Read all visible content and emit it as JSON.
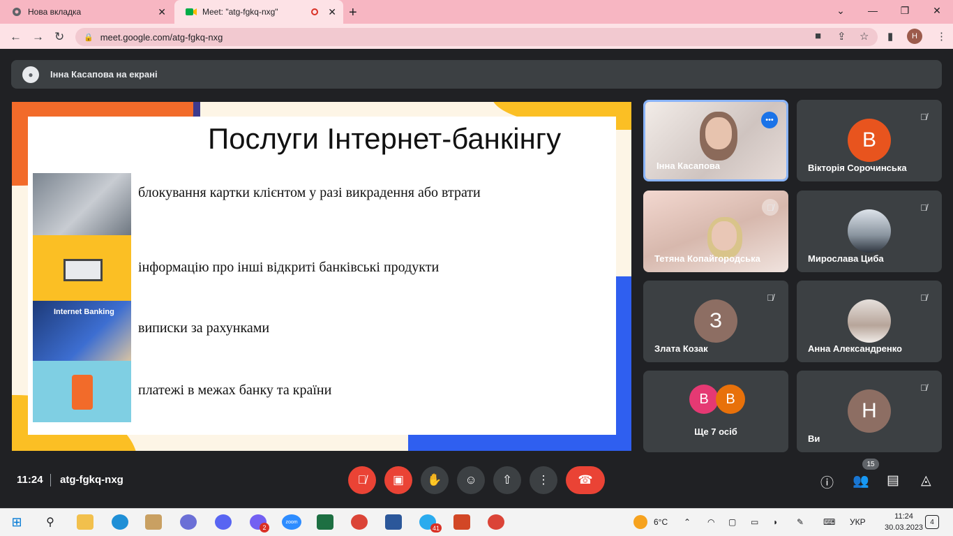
{
  "browser": {
    "tabs": [
      {
        "title": "Нова вкладка"
      },
      {
        "title": "Meet: \"atg-fgkq-nxg\""
      }
    ],
    "url": "meet.google.com/atg-fgkq-nxg",
    "profile_initial": "Н"
  },
  "meet": {
    "presenter_banner": "Інна Касапова на екрані",
    "slide": {
      "title": "Послуги Інтернет-банкінгу",
      "items": [
        "блокування картки клієнтом у разі викрадення або втрати",
        "інформацію про інші відкриті банківські продукти",
        "виписки за рахунками",
        "платежі в межах банку та країни"
      ],
      "image3_caption": "Internet Banking"
    },
    "participants": [
      {
        "name": "Інна Касапова",
        "type": "video"
      },
      {
        "name": "Вікторія Сорочинська",
        "initial": "В",
        "color": "#e8541e"
      },
      {
        "name": "Тетяна Копайгородська",
        "type": "video"
      },
      {
        "name": "Мирослава Циба",
        "type": "photo"
      },
      {
        "name": "Злата Козак",
        "initial": "З",
        "color": "#8d6e63"
      },
      {
        "name": "Анна Александренко",
        "type": "photo"
      },
      {
        "name": "Ще 7 осіб",
        "initials": [
          "В",
          "В"
        ]
      },
      {
        "name": "Ви",
        "initial": "Н",
        "color": "#8d6e63"
      }
    ],
    "bottom": {
      "time": "11:24",
      "meeting_code": "atg-fgkq-nxg",
      "people_count": "15"
    }
  },
  "taskbar": {
    "viber_badge": "2",
    "zoom_label": "zoom",
    "telegram_badge": "41",
    "weather": "6°C",
    "lang": "УКР",
    "time": "11:24",
    "date": "30.03.2023",
    "notifications": "4"
  }
}
